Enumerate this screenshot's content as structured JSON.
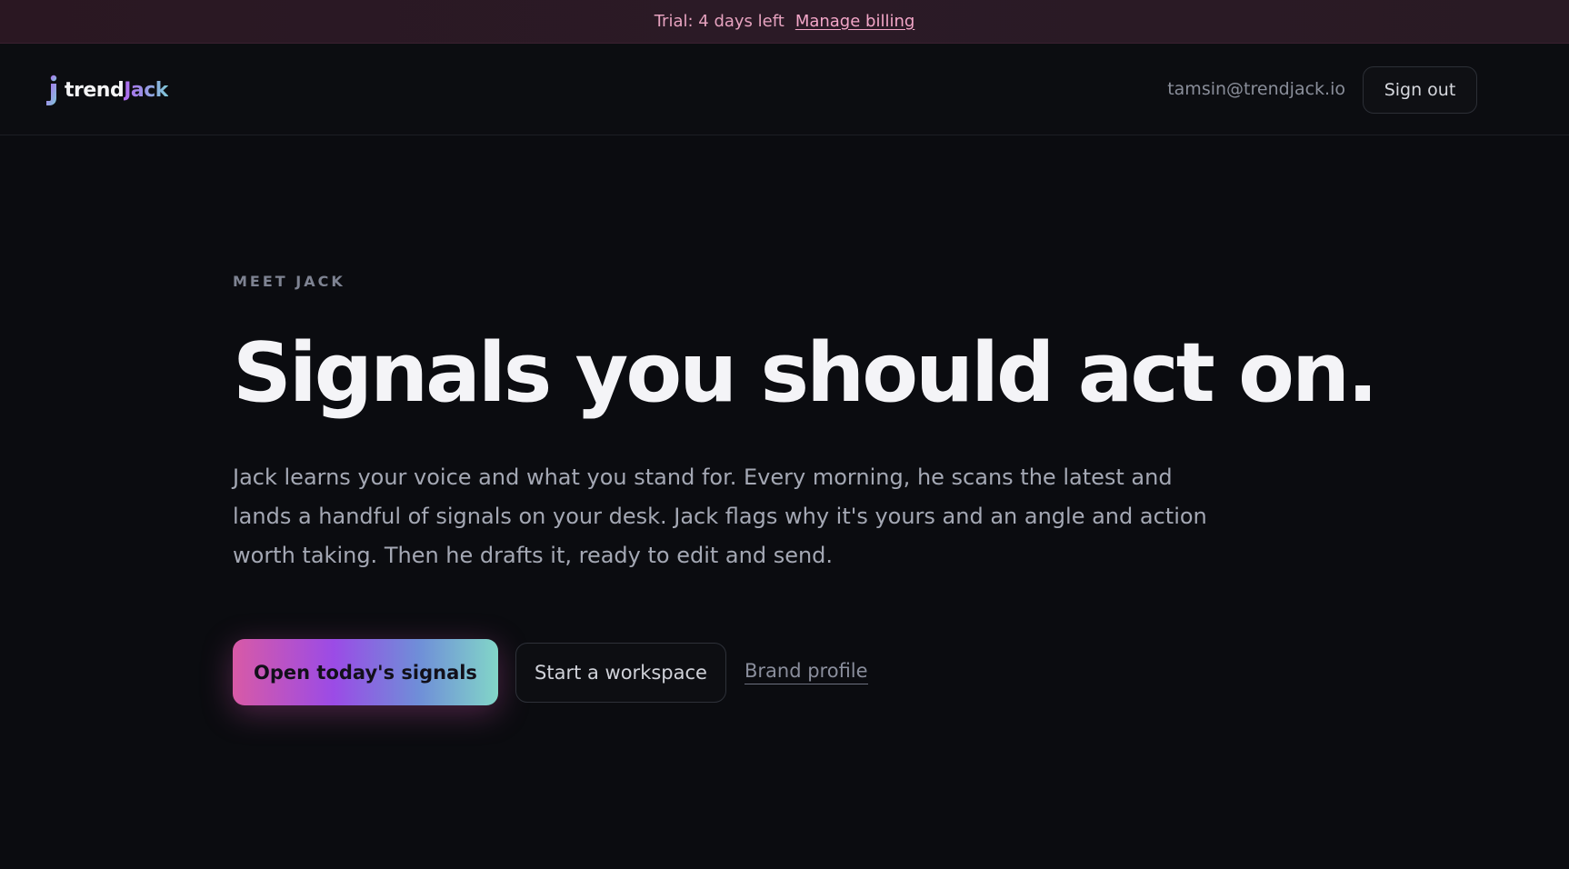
{
  "trial_banner": {
    "text": "Trial: 4 days left",
    "link_label": "Manage billing"
  },
  "brand": {
    "name_part1": "trend",
    "name_part2": "Jack"
  },
  "header": {
    "user_email": "tamsin@trendjack.io",
    "signout_label": "Sign out"
  },
  "hero": {
    "eyebrow": "MEET JACK",
    "headline": "Signals you should act on.",
    "lede": "Jack learns your voice and what you stand for. Every morning, he scans the latest and lands a handful of signals on your desk. Jack flags why it's yours and an angle and action worth taking. Then he drafts it, ready to edit and send."
  },
  "actions": {
    "primary_label": "Open today's signals",
    "secondary_label": "Start a workspace",
    "link_label": "Brand profile"
  },
  "colors": {
    "background": "#0b0c10",
    "accent_pink": "#d85aa6",
    "accent_purple": "#9b4be6",
    "accent_teal": "#82d6c8"
  }
}
